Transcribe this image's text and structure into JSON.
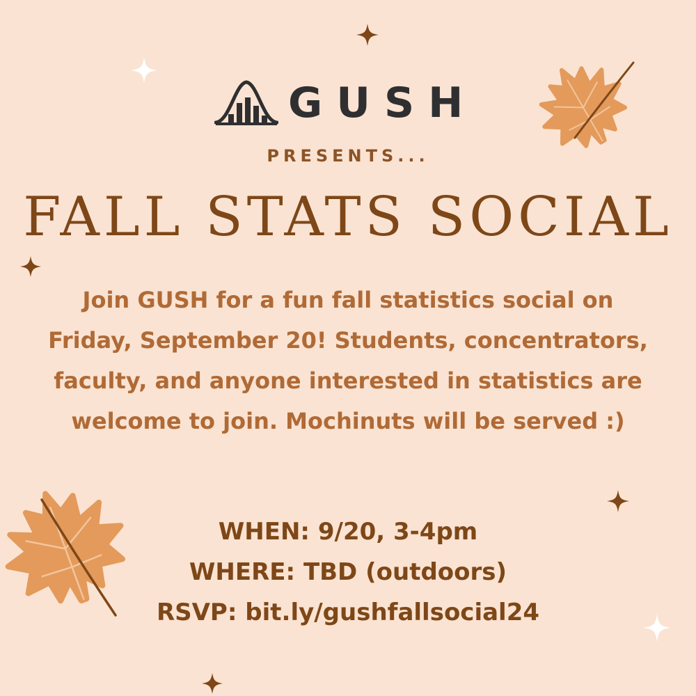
{
  "logo": {
    "wordmark": "GUSH",
    "icon": "bell-curve-bars-icon"
  },
  "presents_label": "PRESENTS...",
  "headline": "FALL STATS SOCIAL",
  "description": "Join GUSH for a fun fall statistics social on Friday, September 20! Students, concentrators, faculty, and anyone interested in statistics are welcome to join. Mochinuts will be served :)",
  "details": {
    "when": "WHEN: 9/20, 3-4pm",
    "where": "WHERE: TBD (outdoors)",
    "rsvp": "RSVP: bit.ly/gushfallsocial24"
  },
  "decorations": {
    "leaf_icon": "maple-leaf-icon",
    "sparkle_icon": "sparkle-icon"
  },
  "colors": {
    "background": "#fae3d2",
    "headline": "#7e4718",
    "body": "#b06a36",
    "leaf": "#e39a5b",
    "logo": "#2f2f31"
  }
}
